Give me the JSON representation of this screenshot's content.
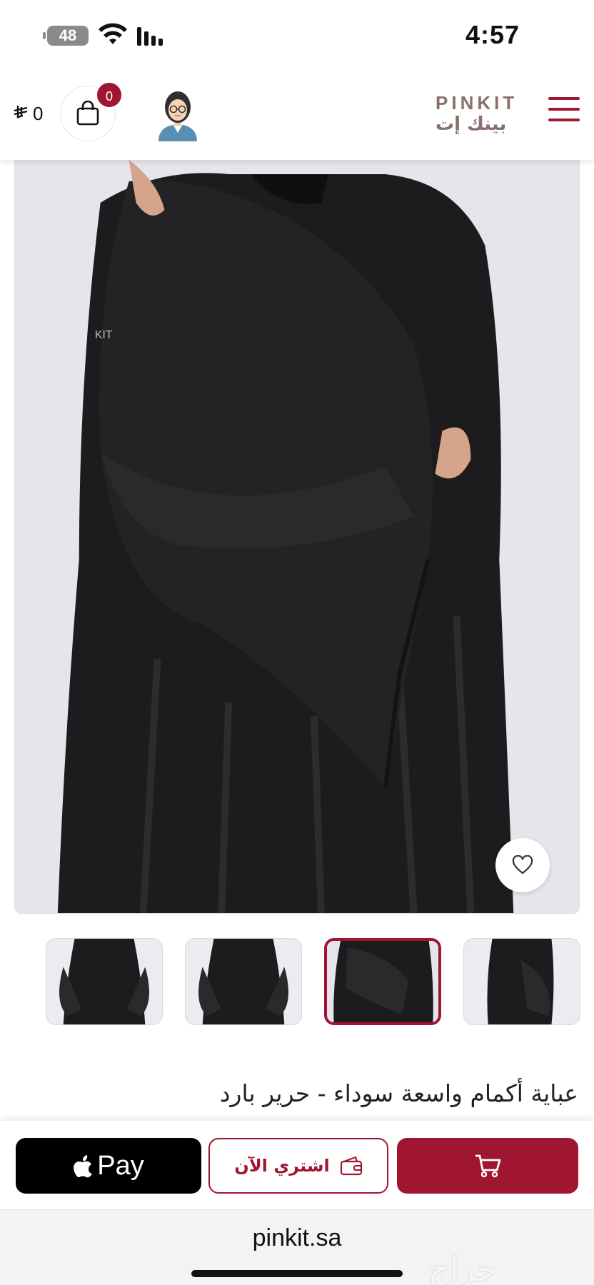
{
  "status_bar": {
    "time": "4:57",
    "battery": "48"
  },
  "header": {
    "cart_total_amount": "0",
    "cart_total_currency_symbol": "⃁",
    "cart_badge_count": "0",
    "logo_latin": "PINKIT",
    "logo_arabic": "بينك إت"
  },
  "product": {
    "image_brand_mark": "KIT",
    "title": "عباية أكمام واسعة سوداء - حرير بارد",
    "thumbnails_count": 4,
    "active_thumbnail_index": 2
  },
  "actions": {
    "apple_pay_label": "Pay",
    "buy_now_label": "اشتري الآن"
  },
  "browser": {
    "url": "pinkit.sa"
  },
  "watermark": "حراج",
  "colors": {
    "brand": "#a01530",
    "logo": "#8a6f6c",
    "image_bg": "#e9e8ee"
  },
  "icons": {
    "menu": "hamburger-icon",
    "cart": "shopping-bag-icon",
    "wishlist": "heart-icon",
    "buy_now": "wallet-icon",
    "add_to_cart": "cart-icon",
    "apple": "apple-logo-icon"
  }
}
